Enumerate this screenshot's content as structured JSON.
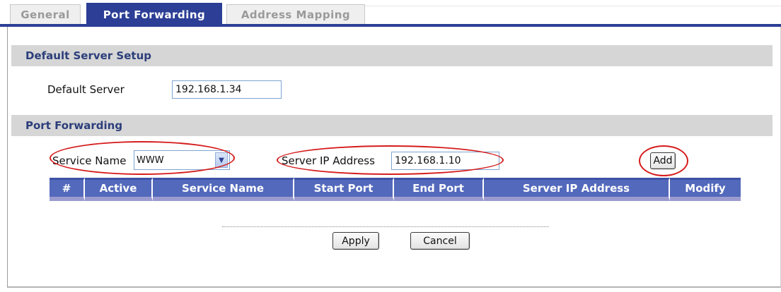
{
  "tabs": [
    {
      "label": "General",
      "active": false
    },
    {
      "label": "Port Forwarding",
      "active": true
    },
    {
      "label": "Address Mapping",
      "active": false
    }
  ],
  "default_server_setup": {
    "header": "Default Server Setup",
    "label": "Default Server",
    "value": "192.168.1.34"
  },
  "port_forwarding": {
    "header": "Port Forwarding",
    "service_name_label": "Service Name",
    "service_name_value": "WWW",
    "server_ip_label": "Server IP Address",
    "server_ip_value": "192.168.1.10",
    "add_label": "Add"
  },
  "table": {
    "columns": [
      "#",
      "Active",
      "Service Name",
      "Start Port",
      "End Port",
      "Server IP Address",
      "Modify"
    ],
    "rows": []
  },
  "actions": {
    "apply_label": "Apply",
    "cancel_label": "Cancel"
  },
  "colors": {
    "accent": "#2c3e95",
    "table_header": "#5369bb",
    "section_bg": "#d6d6d6",
    "highlight": "#d61c1c"
  },
  "icons": {
    "dropdown": "chevron-down-icon"
  }
}
